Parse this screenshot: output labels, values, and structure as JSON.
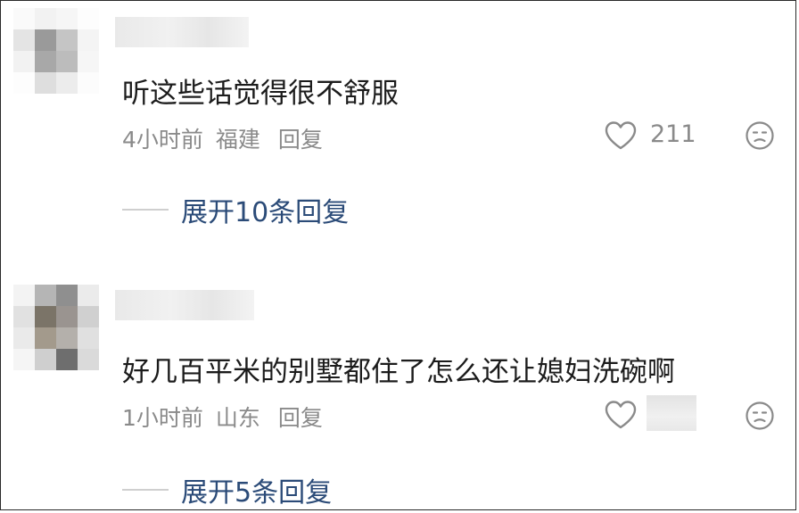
{
  "comments": [
    {
      "text": "听这些话觉得很不舒服",
      "time": "4小时前",
      "location": "福建",
      "reply_label": "回复",
      "likes": "211",
      "expand_label": "展开10条回复"
    },
    {
      "text": "好几百平米的别墅都住了怎么还让媳妇洗碗啊",
      "time": "1小时前",
      "location": "山东",
      "reply_label": "回复",
      "likes": "",
      "expand_label": "展开5条回复"
    }
  ],
  "icons": {
    "like": "heart-outline-icon",
    "dislike": "unhappy-face-icon"
  },
  "colors": {
    "expand_link": "#2b4b78",
    "meta_text": "#8a8a8a",
    "body_text": "#1c1c1c"
  }
}
